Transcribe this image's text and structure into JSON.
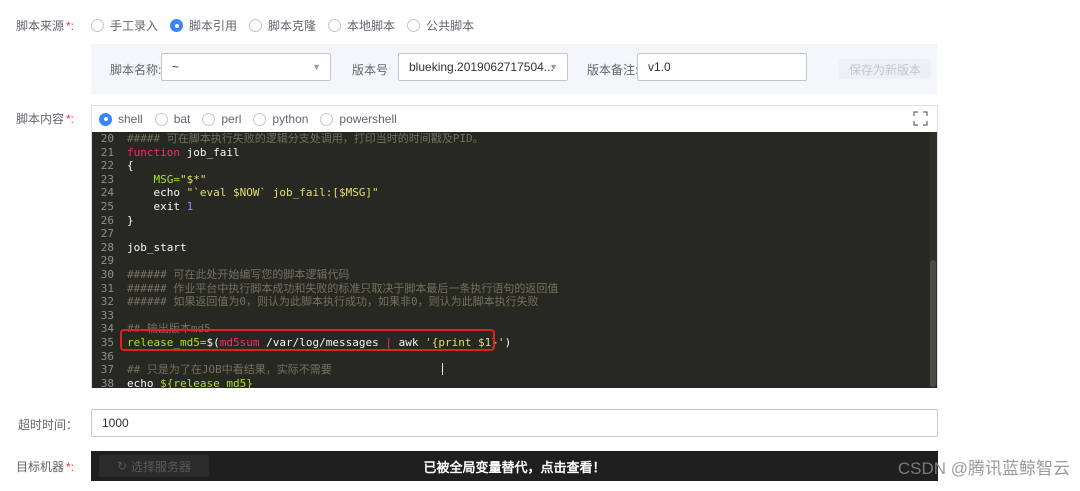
{
  "script_source": {
    "label": "脚本来源",
    "required_mark": "*:",
    "options": [
      "手工录入",
      "脚本引用",
      "脚本克隆",
      "本地脚本",
      "公共脚本"
    ],
    "selected": 1
  },
  "script_ref": {
    "name_label": "脚本名称:",
    "name_value": "~",
    "version_label": "版本号",
    "version_value": "blueking.2019062717504...",
    "note_label": "版本备注:",
    "note_value": "v1.0",
    "save_button": "保存为新版本"
  },
  "script_content": {
    "label": "脚本内容",
    "required_mark": "*:",
    "languages": [
      "shell",
      "bat",
      "perl",
      "python",
      "powershell"
    ],
    "selected_language": 0,
    "fullscreen_icon": "fullscreen-icon"
  },
  "code": {
    "line_numbers": [
      "20",
      "21",
      "22",
      "23",
      "24",
      "25",
      "26",
      "27",
      "28",
      "29",
      "30",
      "31",
      "32",
      "33",
      "34",
      "35",
      "36",
      "37",
      "38"
    ],
    "lines": [
      "##### 可在脚本执行失败的逻辑分支处调用，打印当时的时间戳及PID。",
      "function job_fail",
      "{",
      "    MSG=\"$*\"",
      "    echo \"`eval $NOW` job_fail:[$MSG]\"",
      "    exit 1",
      "}",
      "",
      "job_start",
      "",
      "###### 可在此处开始编写您的脚本逻辑代码",
      "###### 作业平台中执行脚本成功和失败的标准只取决于脚本最后一条执行语句的返回值",
      "###### 如果返回值为0，则认为此脚本执行成功，如果非0，则认为此脚本执行失败",
      "",
      "## 输出版本md5",
      "release_md5=$(md5sum /var/log/messages | awk '{print $1}')",
      "",
      "## 只是为了在JOB中看结果，实际不需要",
      "echo ${release_md5}"
    ]
  },
  "timeout": {
    "label": "超时时间：",
    "value": "1000"
  },
  "target": {
    "label": "目标机器",
    "required_mark": "*:",
    "button": "选择服务器",
    "overlay": "已被全局变量替代，点击查看！"
  },
  "watermark": "CSDN @腾讯蓝鲸智云",
  "colors": {
    "accent": "#3a84ff",
    "required": "#ea3636",
    "editor_bg": "#272822",
    "highlight_box": "#e0221c"
  }
}
